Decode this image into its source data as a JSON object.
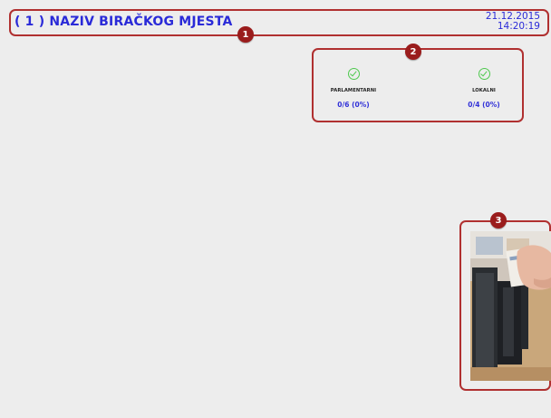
{
  "header": {
    "title": "( 1 ) NAZIV BIRAČKOG MJESTA",
    "date": "21.12.2015",
    "time": "14:20:19"
  },
  "markers": [
    "1",
    "2",
    "3"
  ],
  "elections": [
    {
      "name": "PARLAMENTARNI",
      "count": "0/6 (0%)",
      "status_icon": "check-circle-icon"
    },
    {
      "name": "LOKALNI",
      "count": "0/4 (0%)",
      "status_icon": "check-circle-icon"
    }
  ],
  "card_reader": {
    "icon": "card-reader-photo"
  },
  "colors": {
    "accent_text": "#2a2ad8",
    "frame": "#b03030",
    "marker": "#9a1c1c",
    "check": "#4ec94e",
    "background": "#ededed"
  }
}
